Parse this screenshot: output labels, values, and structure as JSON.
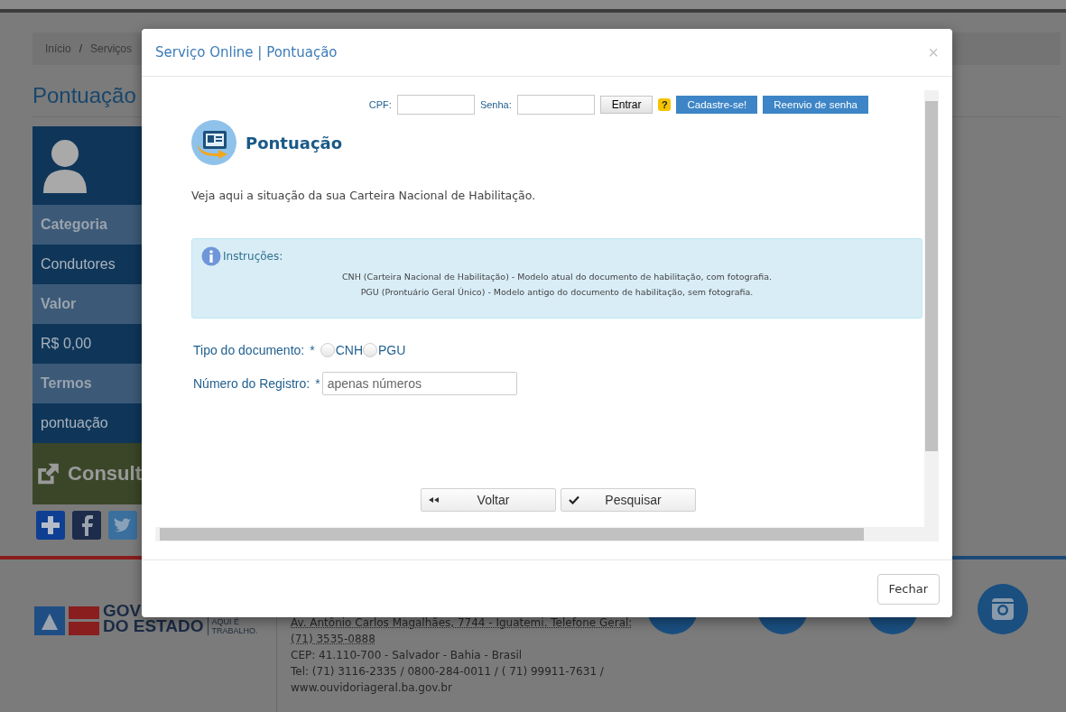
{
  "page": {
    "breadcrumb": {
      "items": [
        "Início",
        "Serviços"
      ],
      "separator": "/"
    },
    "title": "Pontuação",
    "sidebar": [
      {
        "kind": "label",
        "text": "Categoria"
      },
      {
        "kind": "value",
        "text": "Condutores"
      },
      {
        "kind": "label",
        "text": "Valor"
      },
      {
        "kind": "value",
        "text": "R$ 0,00"
      },
      {
        "kind": "label",
        "text": "Termos"
      },
      {
        "kind": "value",
        "text": "pontuação"
      }
    ],
    "consult": "Consult",
    "footer": {
      "logo_lines": [
        "GOV",
        "DO ESTADO"
      ],
      "slogan_lines": [
        "AQUI É",
        "TRABALHO."
      ],
      "address_lines": [
        {
          "text": "Av. Antônio Carlos Magalhães, 7744 - Iguatemi. Telefone Geral:",
          "underlined": true
        },
        {
          "text": "(71) 3535-0888",
          "underlined": true
        },
        {
          "text": "CEP: 41.110-700 - Salvador - Bahia - Brasil",
          "underlined": false
        },
        {
          "text": "Tel: (71) 3116-2335 / 0800-284-0011 / ( 71) 99911-7631 /",
          "underlined": false
        },
        {
          "text": "www.ouvidoriageral.ba.gov.br",
          "underlined": false
        }
      ]
    }
  },
  "modal": {
    "title": "Serviço Online | Pontuação",
    "close": "×",
    "login": {
      "cpf_label": "CPF:",
      "password_label": "Senha:",
      "enter": "Entrar",
      "help": "?",
      "register": "Cadastre-se!",
      "resend": "Reenvio de senha"
    },
    "heading": "Pontuação",
    "description": "Veja aqui a situação da sua Carteira Nacional de Habilitação.",
    "info": {
      "title": "Instruções:",
      "lines": [
        "CNH (Carteira Nacional de Habilitação) - Modelo atual do documento de habilitação, com fotografia.",
        "PGU (Prontuário Geral Único) - Modelo antigo do documento de habilitação, sem fotografia."
      ]
    },
    "document_type": {
      "label": "Tipo do documento:",
      "required": "*",
      "options": [
        {
          "label": "CNH",
          "selected": false
        },
        {
          "label": "PGU",
          "selected": false
        }
      ]
    },
    "registration": {
      "label": "Número do Registro:",
      "required": "*",
      "placeholder": "apenas números"
    },
    "back": "Voltar",
    "search": "Pesquisar",
    "footer_button": "Fechar"
  }
}
